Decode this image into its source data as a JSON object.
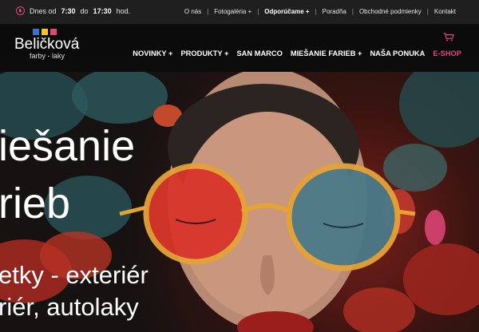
{
  "topbar": {
    "hours_prefix": "Dnes od",
    "hours_from": "7:30",
    "hours_mid": "do",
    "hours_to": "17:30",
    "hours_suffix": "hod.",
    "links": [
      "O nás",
      "Fotogaléria +",
      "Odporúčame +",
      "Poradňa",
      "Obchodné podmienky",
      "Kontakt"
    ]
  },
  "logo": {
    "brand": "Beličková",
    "tagline": "farby - laky",
    "square_colors": [
      "#3b6fd1",
      "#f2c230",
      "#e0467a"
    ]
  },
  "nav": {
    "items": [
      "NOVINKY +",
      "PRODUKTY +",
      "SAN MARCO",
      "MIEŠANIE FARIEB +",
      "NAŠA PONUKA",
      "E-SHOP"
    ]
  },
  "hero": {
    "title_line1": "iešanie",
    "title_line2": "rieb",
    "sub_line1": "etky - exteriér",
    "sub_line2": "riér, autolaky"
  },
  "colors": {
    "accent": "#e0467a",
    "topbar_bg": "#1f1f1f"
  }
}
